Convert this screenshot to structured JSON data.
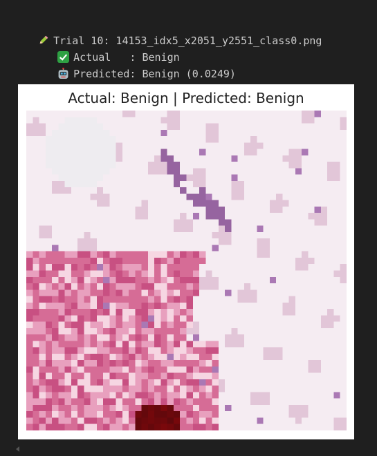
{
  "output": {
    "line1": {
      "icon": "pencil-icon",
      "text": "Trial 10: 14153_idx5_x2051_y2551_class0.png"
    },
    "line2": {
      "icon": "check-icon",
      "text": "Actual   : Benign"
    },
    "line3": {
      "icon": "robot-icon",
      "text": "Predicted: Benign (0.0249)"
    }
  },
  "figure": {
    "title": "Actual: Benign | Predicted: Benign"
  },
  "colors": {
    "background": "#1f1f1f",
    "text": "#cccccc",
    "check": "#2ea043"
  }
}
